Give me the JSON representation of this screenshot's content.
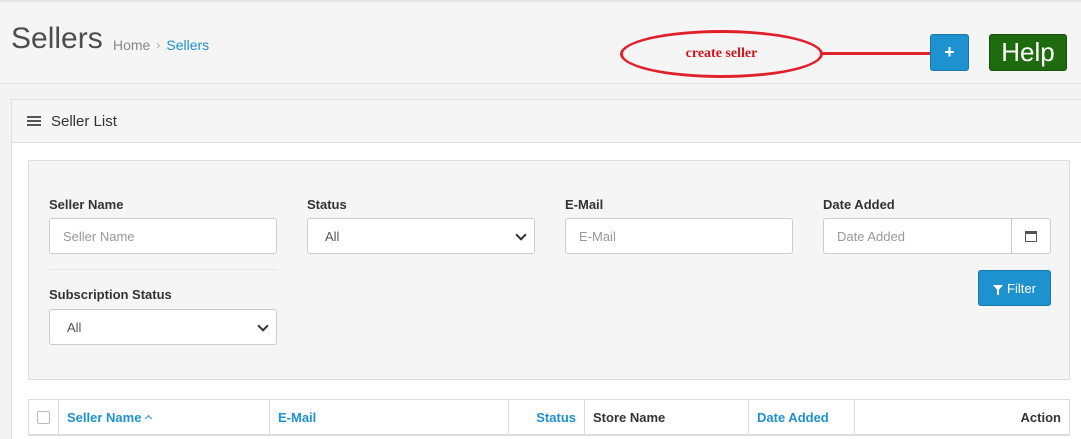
{
  "header": {
    "title": "Sellers",
    "breadcrumb": [
      {
        "label": "Home"
      },
      {
        "label": "Sellers"
      }
    ],
    "breadcrumb_separator": "›",
    "add_button_symbol": "+",
    "help_label": "Help",
    "annotation_text": "create seller"
  },
  "panel": {
    "title": "Seller List",
    "icon": "list-icon"
  },
  "filters": {
    "seller_name": {
      "label": "Seller Name",
      "placeholder": "Seller Name"
    },
    "status": {
      "label": "Status",
      "value": "All"
    },
    "email": {
      "label": "E-Mail",
      "placeholder": "E-Mail"
    },
    "date_added": {
      "label": "Date Added",
      "placeholder": "Date Added"
    },
    "subscription_status": {
      "label": "Subscription Status",
      "value": "All"
    },
    "filter_button": "Filter"
  },
  "table": {
    "columns": [
      {
        "label": "Seller Name",
        "sortable": true
      },
      {
        "label": "E-Mail",
        "sortable": true
      },
      {
        "label": "Status",
        "sortable": true
      },
      {
        "label": "Store Name",
        "sortable": false
      },
      {
        "label": "Date Added",
        "sortable": true
      },
      {
        "label": "Action",
        "sortable": false
      }
    ]
  },
  "colors": {
    "primary": "#1e91cf",
    "help": "#1e6b0f",
    "annotation": "#e0202a"
  }
}
